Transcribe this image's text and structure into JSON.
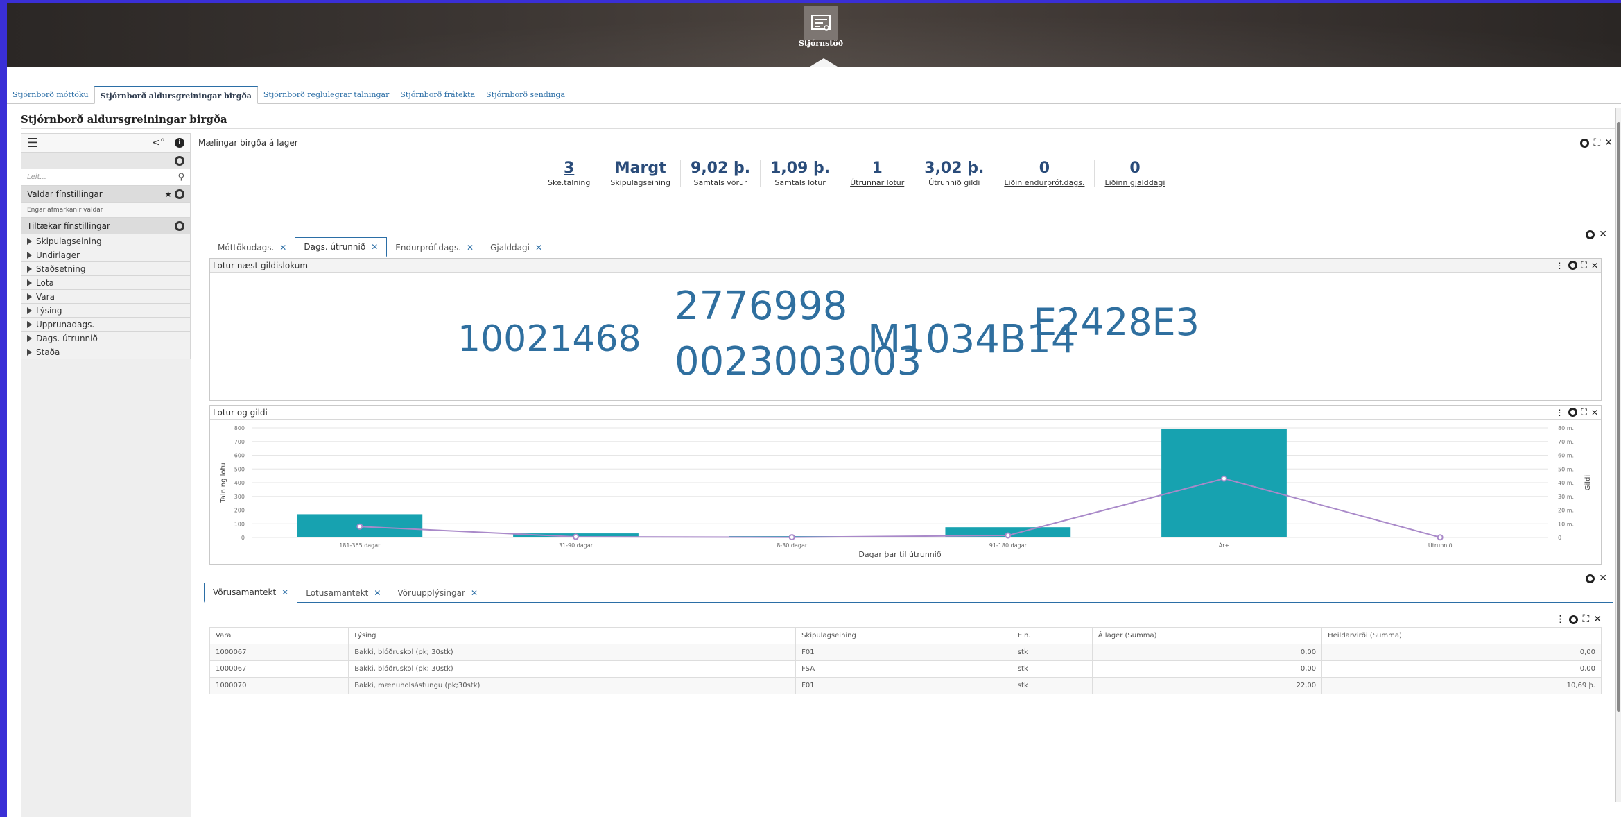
{
  "header": {
    "home_label": "Stjórnstöð"
  },
  "top_tabs": [
    {
      "label": "Stjórnborð móttöku",
      "active": false
    },
    {
      "label": "Stjórnborð aldursgreiningar birgða",
      "active": true
    },
    {
      "label": "Stjórnborð reglulegrar talningar",
      "active": false
    },
    {
      "label": "Stjórnborð frátekta",
      "active": false
    },
    {
      "label": "Stjórnborð sendinga",
      "active": false
    }
  ],
  "page_title": "Stjórnborð aldursgreiningar birgða",
  "left_panel": {
    "search_placeholder": "Leit...",
    "selected_header": "Valdar fínstillingar",
    "selected_empty": "Engar afmarkanir valdar",
    "available_header": "Tiltækar fínstillingar",
    "items": [
      "Skipulagseining",
      "Undirlager",
      "Staðsetning",
      "Lota",
      "Vara",
      "Lýsing",
      "Upprunadags.",
      "Dags. útrunnið",
      "Staða"
    ]
  },
  "measures": {
    "title": "Mælingar birgða á lager",
    "kpis": [
      {
        "value": "3",
        "label": "Ske.talning",
        "value_link": true,
        "label_link": false
      },
      {
        "value": "Margt",
        "label": "Skipulagseining",
        "value_link": false,
        "label_link": false
      },
      {
        "value": "9,02 þ.",
        "label": "Samtals vörur",
        "value_link": false,
        "label_link": false
      },
      {
        "value": "1,09 þ.",
        "label": "Samtals lotur",
        "value_link": false,
        "label_link": false
      },
      {
        "value": "1",
        "label": "Útrunnar lotur",
        "value_link": false,
        "label_link": true
      },
      {
        "value": "3,02 þ.",
        "label": "Útrunnið gildi",
        "value_link": false,
        "label_link": false
      },
      {
        "value": "0",
        "label": "Liðin endurpróf.dags.",
        "value_link": false,
        "label_link": true
      },
      {
        "value": "0",
        "label": "Liðinn gjalddagi",
        "value_link": false,
        "label_link": true
      }
    ]
  },
  "chart_tabs": [
    {
      "label": "Móttökudags.",
      "active": false
    },
    {
      "label": "Dags. útrunnið",
      "active": true
    },
    {
      "label": "Endurpróf.dags.",
      "active": false
    },
    {
      "label": "Gjalddagi",
      "active": false
    }
  ],
  "wordcloud": {
    "title": "Lotur næst gildislokum",
    "words": [
      "2776998",
      "10021468",
      "0023003003",
      "M1034B14",
      "E2428E3"
    ]
  },
  "chart_panel_title": "Lotur og gildi",
  "chart_data": {
    "type": "bar",
    "categories": [
      "181-365 dagar",
      "31-90 dagar",
      "8-30 dagar",
      "91-180 dagar",
      "Ár+",
      "Útrunnið"
    ],
    "series": [
      {
        "name": "Talning lotu",
        "type": "bar",
        "axis": "left",
        "values": [
          170,
          30,
          10,
          75,
          790,
          0
        ]
      },
      {
        "name": "Gildi",
        "type": "line",
        "axis": "right",
        "values": [
          8,
          0.5,
          0.2,
          1.5,
          43,
          0.1
        ]
      }
    ],
    "xlabel": "Dagar þar til útrunnið",
    "ylabel": "Talning lotu",
    "y2label": "Gildi",
    "ylim": [
      0,
      800
    ],
    "y2lim": [
      0,
      80
    ],
    "yticks": [
      "0",
      "100",
      "200",
      "300",
      "400",
      "500",
      "600",
      "700",
      "800"
    ],
    "y2ticks": [
      "0",
      "10 m.",
      "20 m.",
      "30 m.",
      "40 m.",
      "50 m.",
      "60 m.",
      "70 m.",
      "80 m."
    ],
    "grid": true,
    "colors": {
      "bar": "#17a2b0",
      "line": "#a989c9"
    }
  },
  "bottom_tabs": [
    {
      "label": "Vörusamantekt",
      "active": true
    },
    {
      "label": "Lotusamantekt",
      "active": false
    },
    {
      "label": "Vöruupplýsingar",
      "active": false
    }
  ],
  "table": {
    "columns": [
      "Vara",
      "Lýsing",
      "Skipulagseining",
      "Ein.",
      "Á lager (Summa)",
      "Heildarvirði (Summa)"
    ],
    "rows": [
      [
        "1000067",
        "Bakki, blóðruskol (pk; 30stk)",
        "F01",
        "stk",
        "0,00",
        "0,00"
      ],
      [
        "1000067",
        "Bakki, blóðruskol (pk; 30stk)",
        "FSA",
        "stk",
        "0,00",
        "0,00"
      ],
      [
        "1000070",
        "Bakki, mænuholsástungu (pk;30stk)",
        "F01",
        "stk",
        "22,00",
        "10,69 þ."
      ]
    ]
  }
}
